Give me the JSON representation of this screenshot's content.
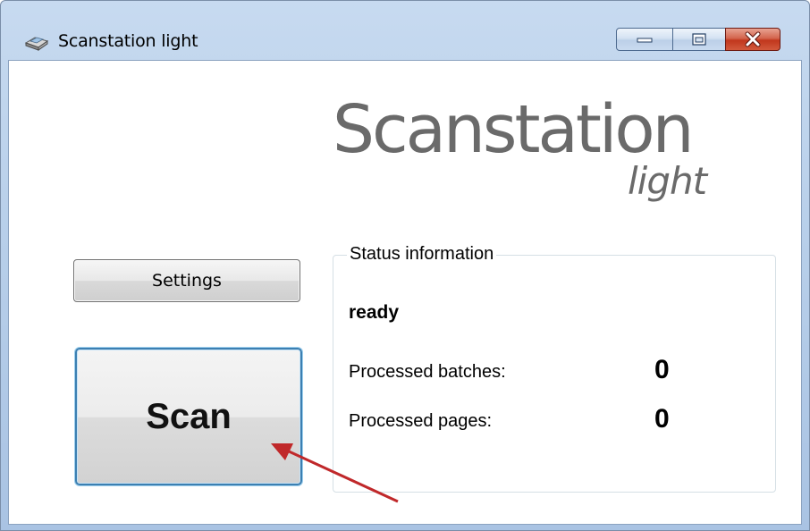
{
  "window": {
    "title": "Scanstation light",
    "icon": "scanner-icon"
  },
  "logo": {
    "main": "Scanstation",
    "sub": "light"
  },
  "buttons": {
    "settings_label": "Settings",
    "scan_label": "Scan"
  },
  "status": {
    "group_label": "Status information",
    "state": "ready",
    "rows": [
      {
        "label": "Processed batches:",
        "value": "0"
      },
      {
        "label": "Processed pages:",
        "value": "0"
      }
    ]
  },
  "annotation": {
    "arrow_color": "#c0282a"
  }
}
